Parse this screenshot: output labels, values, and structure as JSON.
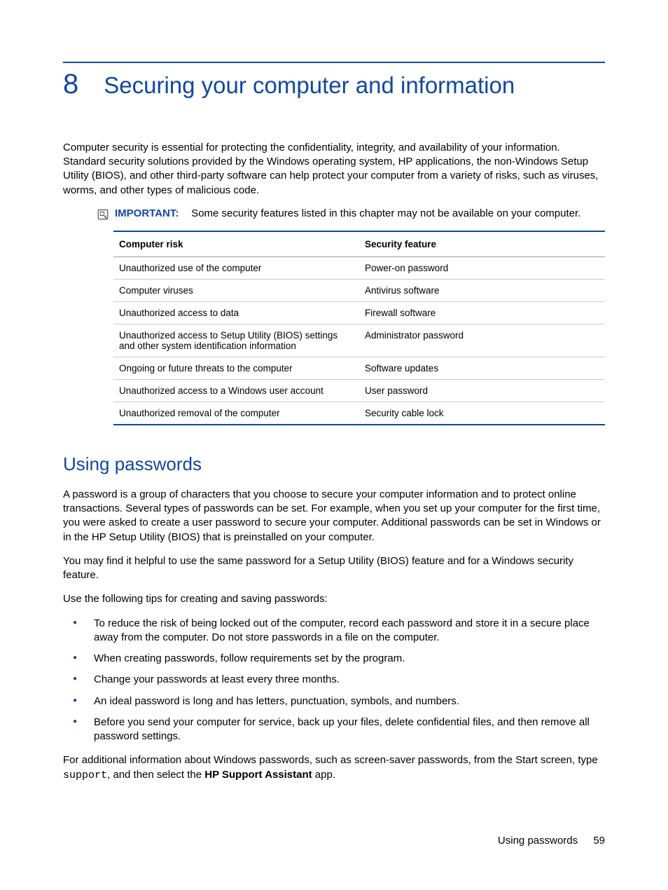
{
  "chapter": {
    "number": "8",
    "title": "Securing your computer and information"
  },
  "intro_para": "Computer security is essential for protecting the confidentiality, integrity, and availability of your information. Standard security solutions provided by the Windows operating system, HP applications, the non-Windows Setup Utility (BIOS), and other third-party software can help protect your computer from a variety of risks, such as viruses, worms, and other types of malicious code.",
  "important_note": {
    "label": "IMPORTANT:",
    "text": "Some security features listed in this chapter may not be available on your computer."
  },
  "table": {
    "headers": [
      "Computer risk",
      "Security feature"
    ],
    "rows": [
      [
        "Unauthorized use of the computer",
        "Power-on password"
      ],
      [
        "Computer viruses",
        "Antivirus software"
      ],
      [
        "Unauthorized access to data",
        "Firewall software"
      ],
      [
        "Unauthorized access to Setup Utility (BIOS) settings and other system identification information",
        "Administrator password"
      ],
      [
        "Ongoing or future threats to the computer",
        "Software updates"
      ],
      [
        "Unauthorized access to a Windows user account",
        "User password"
      ],
      [
        "Unauthorized removal of the computer",
        "Security cable lock"
      ]
    ]
  },
  "section": {
    "title": "Using passwords",
    "para1": "A password is a group of characters that you choose to secure your computer information and to protect online transactions. Several types of passwords can be set. For example, when you set up your computer for the first time, you were asked to create a user password to secure your computer. Additional passwords can be set in Windows or in the HP Setup Utility (BIOS) that is preinstalled on your computer.",
    "para2": "You may find it helpful to use the same password for a Setup Utility (BIOS) feature and for a Windows security feature.",
    "para3": "Use the following tips for creating and saving passwords:",
    "bullets": [
      "To reduce the risk of being locked out of the computer, record each password and store it in a secure place away from the computer. Do not store passwords in a file on the computer.",
      "When creating passwords, follow requirements set by the program.",
      "Change your passwords at least every three months.",
      "An ideal password is long and has letters, punctuation, symbols, and numbers.",
      "Before you send your computer for service, back up your files, delete confidential files, and then remove all password settings."
    ],
    "closing_pre": "For additional information about Windows passwords, such as screen-saver passwords, from the Start screen, type ",
    "closing_code": "support",
    "closing_mid": ", and then select the ",
    "closing_bold": "HP Support Assistant",
    "closing_post": " app."
  },
  "footer": {
    "label": "Using passwords",
    "page": "59"
  }
}
